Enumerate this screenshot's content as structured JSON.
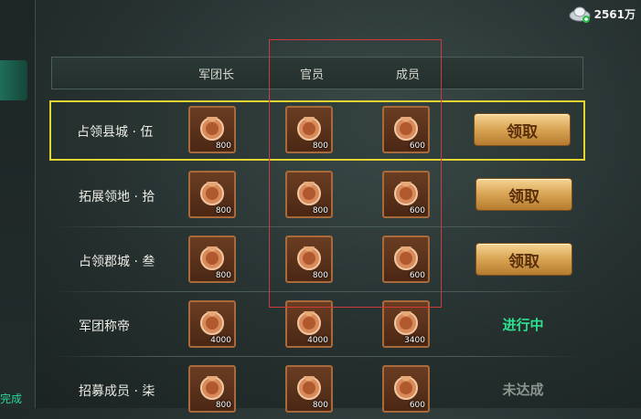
{
  "currency": {
    "amount": "2561万",
    "icon": "silver-ingot-icon"
  },
  "left_panel": {
    "status_text": "完成",
    "status_color": "#2ad89c"
  },
  "table": {
    "headers": [
      "军团长",
      "官员",
      "成员"
    ],
    "rows": [
      {
        "label": "占领县城 · 伍",
        "rewards": [
          "800",
          "800",
          "600"
        ],
        "action": {
          "type": "button",
          "text": "领取"
        },
        "highlighted": true
      },
      {
        "label": "拓展领地 · 拾",
        "rewards": [
          "800",
          "800",
          "600"
        ],
        "action": {
          "type": "button",
          "text": "领取"
        }
      },
      {
        "label": "占领郡城 · 叁",
        "rewards": [
          "800",
          "800",
          "600"
        ],
        "action": {
          "type": "button",
          "text": "领取"
        }
      },
      {
        "label": "军团称帝",
        "rewards": [
          "4000",
          "4000",
          "3400"
        ],
        "action": {
          "type": "status",
          "text": "进行中",
          "color": "#2ee08f"
        }
      },
      {
        "label": "招募成员 · 柒",
        "rewards": [
          "800",
          "800",
          "600"
        ],
        "action": {
          "type": "status",
          "text": "未达成",
          "color": "#8d958f"
        }
      }
    ]
  },
  "colors": {
    "highlight_border": "#e3d431",
    "annotation_box": "#d03a3a",
    "button_gold": "#d8a453"
  }
}
